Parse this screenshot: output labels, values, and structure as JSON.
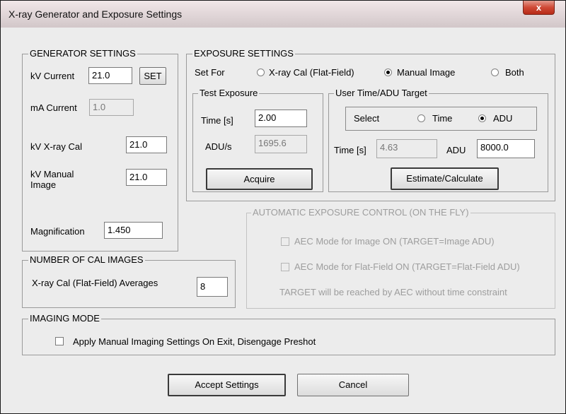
{
  "window": {
    "title": "X-ray Generator and Exposure Settings",
    "close_glyph": "x"
  },
  "generator": {
    "legend": "GENERATOR SETTINGS",
    "kv_current_label": "kV Current",
    "kv_current_value": "21.0",
    "set_label": "SET",
    "ma_current_label": "mA Current",
    "ma_current_value": "1.0",
    "kv_xray_cal_label": "kV X-ray Cal",
    "kv_xray_cal_value": "21.0",
    "kv_manual_label_1": "kV Manual",
    "kv_manual_label_2": "Image",
    "kv_manual_value": "21.0",
    "magnification_label": "Magnification",
    "magnification_value": "1.450"
  },
  "exposure": {
    "legend": "EXPOSURE SETTINGS",
    "set_for_label": "Set For",
    "options": [
      {
        "label": "X-ray Cal (Flat-Field)",
        "selected": false
      },
      {
        "label": "Manual Image",
        "selected": true
      },
      {
        "label": "Both",
        "selected": false
      }
    ],
    "test": {
      "legend": "Test Exposure",
      "time_label": "Time [s]",
      "time_value": "2.00",
      "adu_label": "ADU/s",
      "adu_value": "1695.6",
      "acquire_label": "Acquire"
    },
    "target": {
      "legend": "User Time/ADU Target",
      "select_label": "Select",
      "time_option": "Time",
      "adu_option": "ADU",
      "selected": "ADU",
      "time_label": "Time [s]",
      "time_value": "4.63",
      "adu_label": "ADU",
      "adu_value": "8000.0",
      "estimate_label": "Estimate/Calculate"
    }
  },
  "aec": {
    "legend": "AUTOMATIC EXPOSURE CONTROL (ON THE FLY)",
    "image_on_label": "AEC Mode for Image ON (TARGET=Image ADU)",
    "flat_on_label": "AEC Mode for Flat-Field ON (TARGET=Flat-Field ADU)",
    "note": "TARGET will be reached by AEC without time constraint"
  },
  "cal_images": {
    "legend": "NUMBER OF CAL IMAGES",
    "averages_label": "X-ray Cal (Flat-Field) Averages",
    "averages_value": "8"
  },
  "imaging_mode": {
    "legend": "IMAGING MODE",
    "apply_label": "Apply Manual Imaging Settings On Exit, Disengage Preshot"
  },
  "footer": {
    "accept_label": "Accept Settings",
    "cancel_label": "Cancel"
  }
}
